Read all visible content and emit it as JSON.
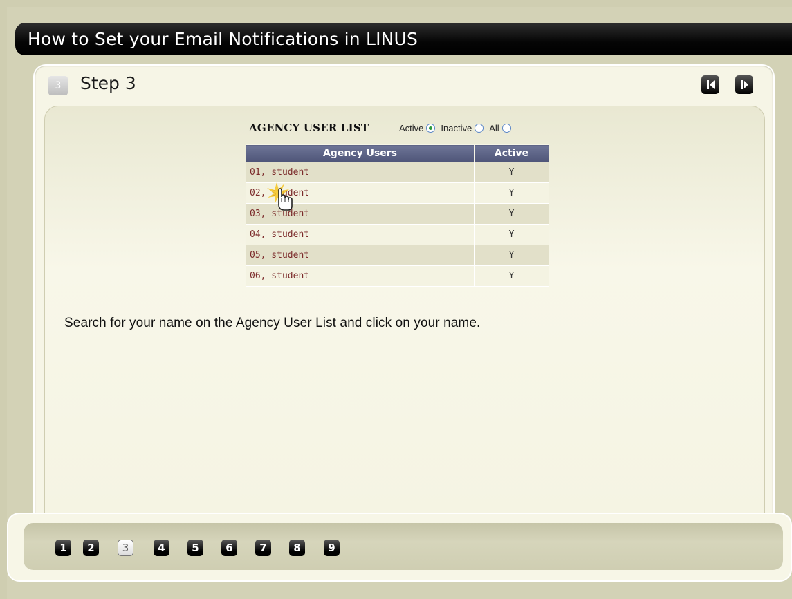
{
  "title": "How to Set your Email Notifications in LINUS",
  "step": {
    "badge": "3",
    "title": "Step 3",
    "prev_icon": "prev-icon",
    "next_icon": "next-icon"
  },
  "agency": {
    "header": "AGENCY USER LIST",
    "filters": {
      "active": "Active",
      "inactive": "Inactive",
      "all": "All",
      "selected": "Active"
    },
    "columns": [
      "Agency Users",
      "Active"
    ],
    "rows": [
      {
        "name": "01, student",
        "active": "Y"
      },
      {
        "name": "02, student",
        "active": "Y"
      },
      {
        "name": "03, student",
        "active": "Y"
      },
      {
        "name": "04, student",
        "active": "Y"
      },
      {
        "name": "05, student",
        "active": "Y"
      },
      {
        "name": "06, student",
        "active": "Y"
      }
    ]
  },
  "instruction": "Search for your name on the Agency User List and click on your name.",
  "pages": [
    "1",
    "2",
    "3",
    "4",
    "5",
    "6",
    "7",
    "8",
    "9"
  ],
  "current_page": "3",
  "colors": {
    "header_bg": "#555b7e",
    "name_text": "#7b2a2a",
    "radio_selected": "#2e9a3d",
    "background": "#cfceb1"
  }
}
